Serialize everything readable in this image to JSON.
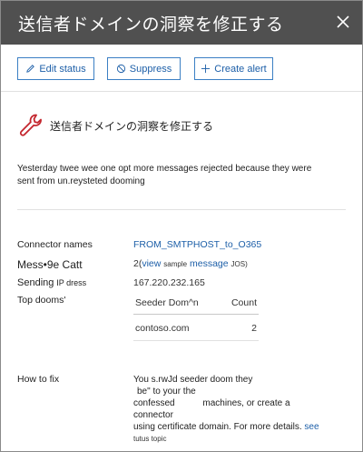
{
  "window": {
    "title": "送信者ドメインの洞察を修正する",
    "close_icon": "close-icon"
  },
  "toolbar": {
    "edit_label": "Edit status",
    "suppress_label": "Suppress",
    "create_alert_label": "Create alert"
  },
  "insight": {
    "icon": "wrench-icon",
    "accent_color": "#c4262e",
    "heading": "送信者ドメインの洞察を修正する",
    "description": "Yesterday twee wee one opt more messages rejected because they were sent from un.reysteted dooming"
  },
  "details": {
    "connector_label": "Connector names",
    "connector_value": "FROM_SMTPHOST_to_O365",
    "message_count_label": "Mess•9e Catt",
    "message_count_prefix": "2(",
    "message_count_view": "view",
    "message_count_sample": "sample",
    "message_count_message": "message",
    "message_count_suffix": "JOS)",
    "sending_ip_label": "Sending",
    "sending_ip_label_small": "IP dress",
    "sending_ip_value": "167.220.232.165",
    "top_domains_label": "Top dooms'",
    "table": {
      "col_domain": "Seeder Dom^n",
      "col_count": "Count",
      "rows": [
        {
          "domain": "contoso.com",
          "count": "2"
        }
      ]
    },
    "how_to_fix_label": "How to fix",
    "how_to_fix_line1": "You s.rwJd seeder doom they",
    "how_to_fix_line2": "be\" to your the",
    "how_to_fix_line3": "confessed",
    "how_to_fix_line3b": "machines, or create a connector",
    "how_to_fix_line4": "using certificate domain. For more details.",
    "how_to_fix_link": "see",
    "how_to_fix_line5": "tutus topic"
  },
  "colors": {
    "titlebar_bg": "#505050",
    "link": "#1d5fa8",
    "button_border": "#3b7fc4"
  }
}
